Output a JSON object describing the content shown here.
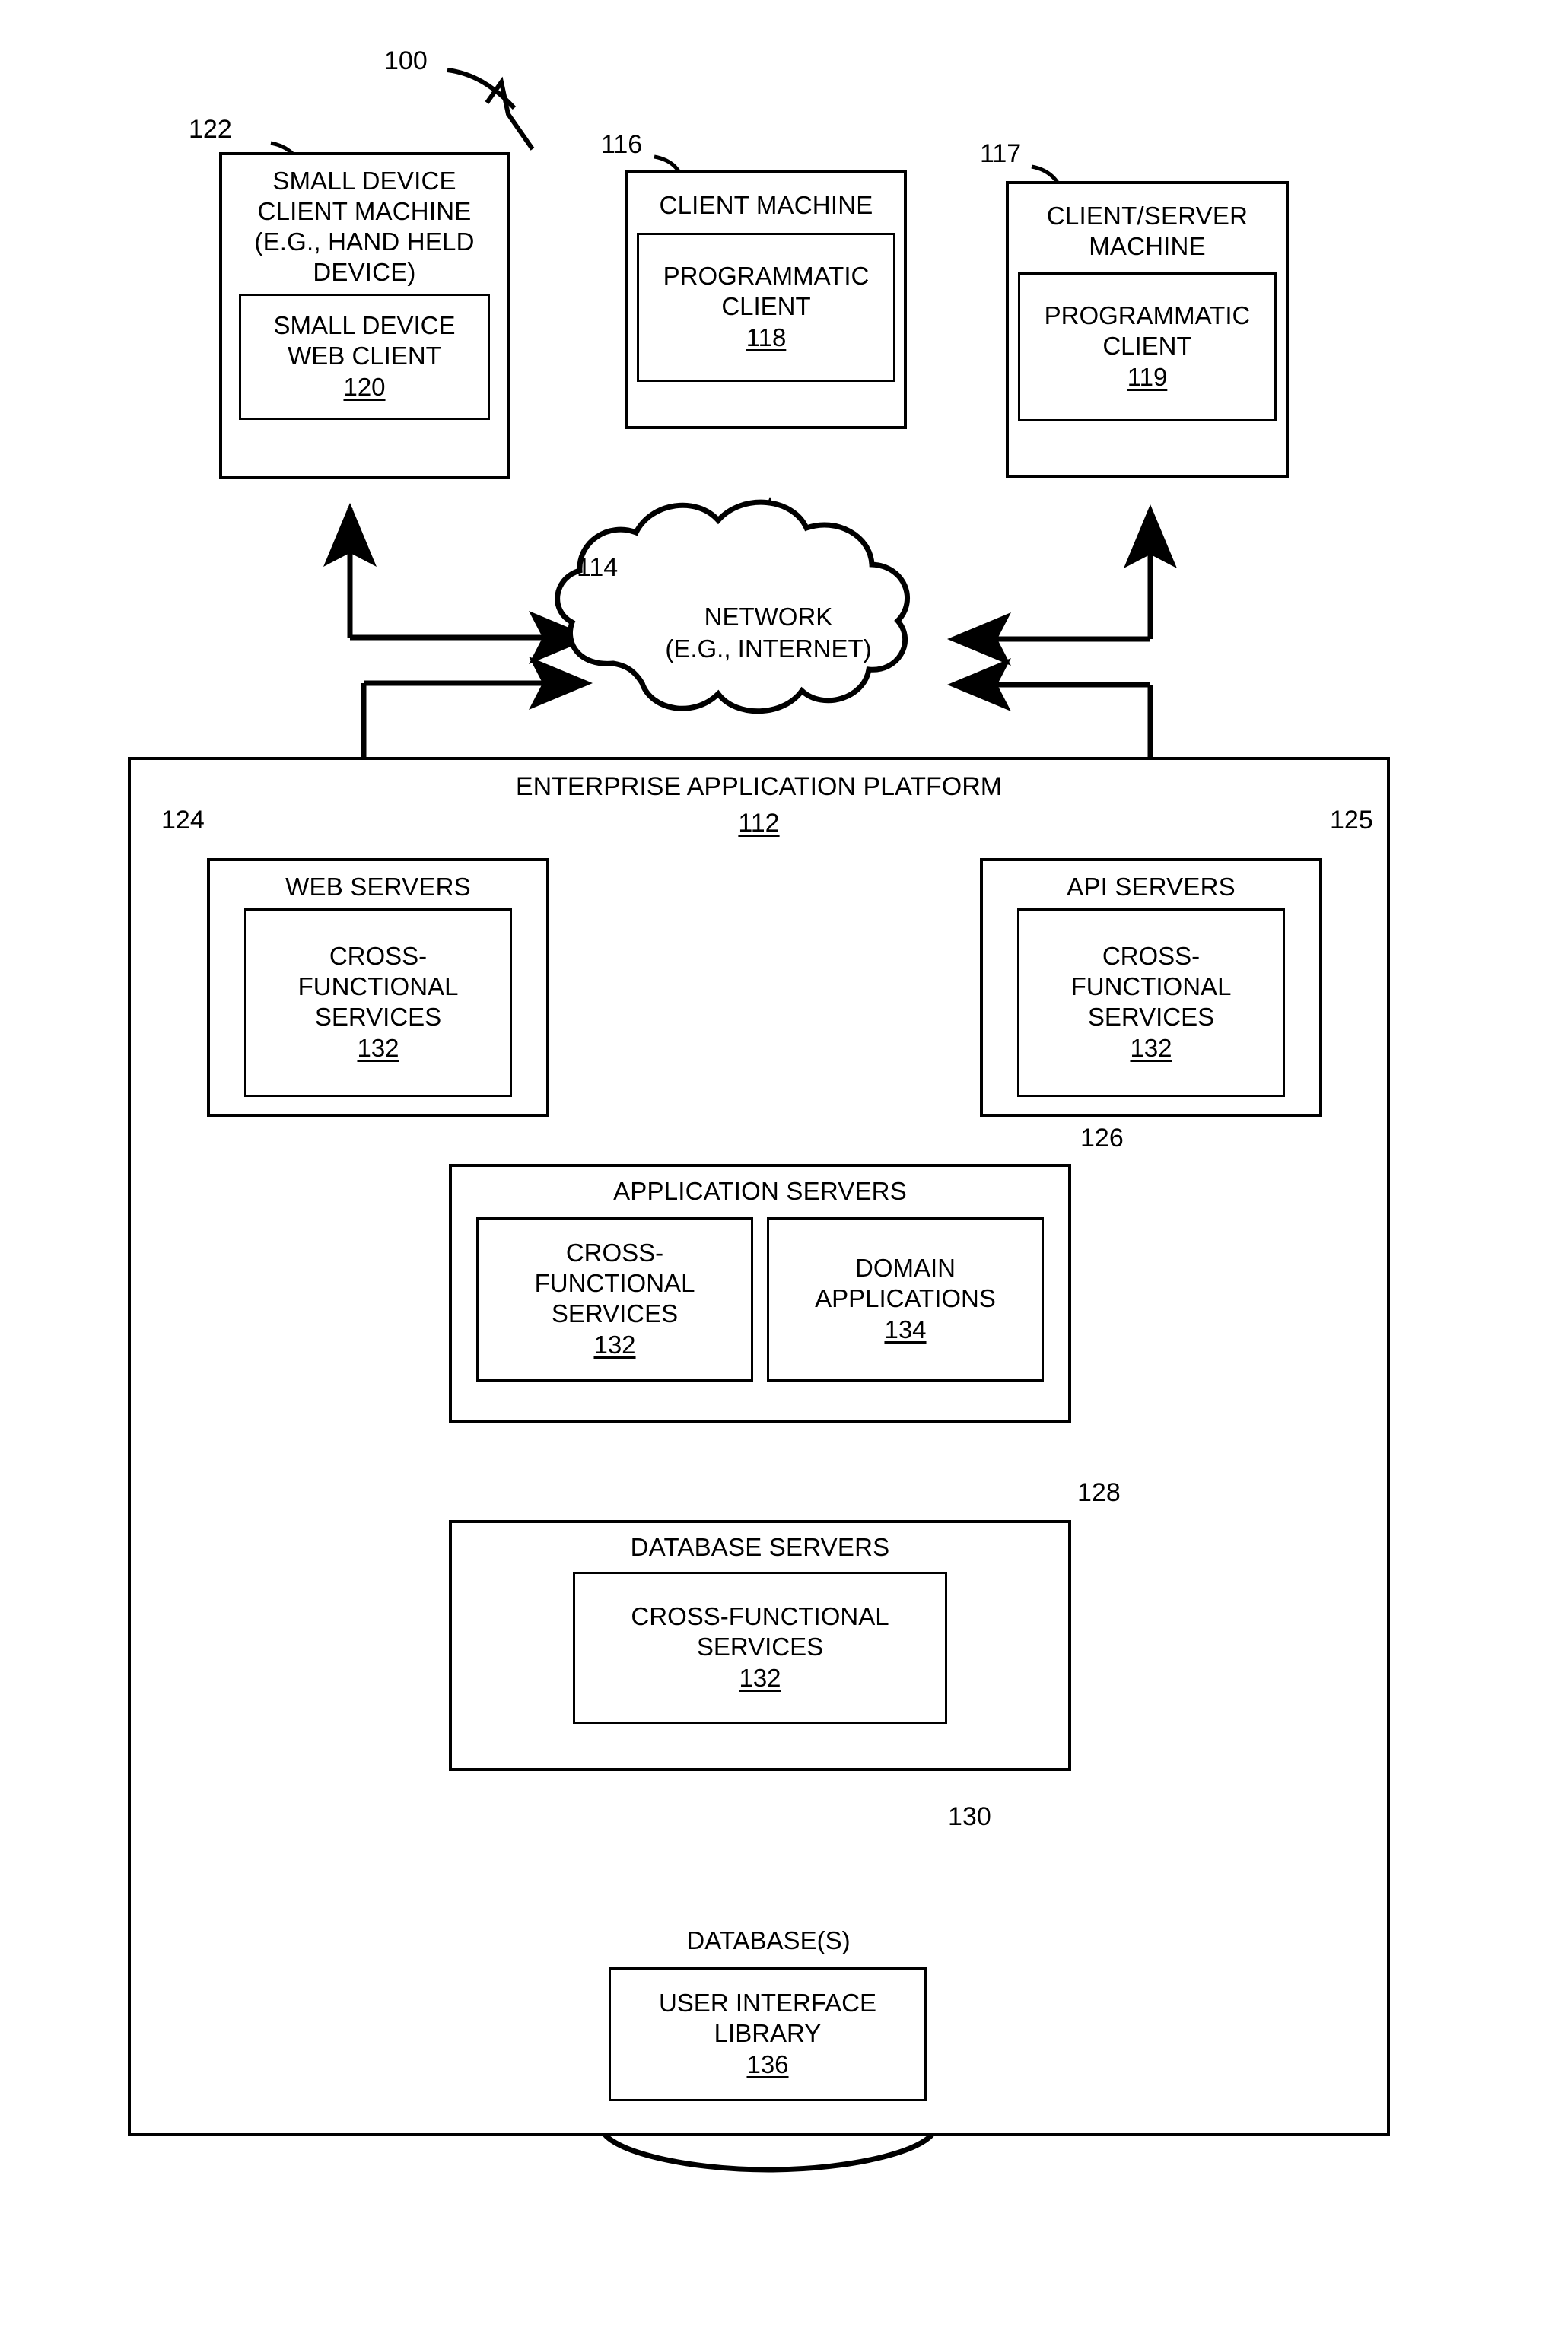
{
  "figure": {
    "figure_ref": "100"
  },
  "nodes": {
    "small_device_client_machine": {
      "ref": "122",
      "title": "SMALL DEVICE\nCLIENT MACHINE\n(E.G., HAND HELD\nDEVICE)",
      "inner": {
        "title": "SMALL DEVICE\nWEB CLIENT",
        "ref": "120"
      }
    },
    "client_machine": {
      "ref": "116",
      "title": "CLIENT MACHINE",
      "inner": {
        "title": "PROGRAMMATIC\nCLIENT",
        "ref": "118"
      }
    },
    "client_server_machine": {
      "ref": "117",
      "title": "CLIENT/SERVER\nMACHINE",
      "inner": {
        "title": "PROGRAMMATIC\nCLIENT",
        "ref": "119"
      }
    },
    "network": {
      "ref": "114",
      "title": "NETWORK\n(E.G., INTERNET)"
    },
    "enterprise_application_platform": {
      "ref": "112",
      "title": "ENTERPRISE APPLICATION PLATFORM"
    },
    "web_servers": {
      "ref": "124",
      "title": "WEB SERVERS",
      "inner": {
        "title": "CROSS-\nFUNCTIONAL\nSERVICES",
        "ref": "132"
      }
    },
    "api_servers": {
      "ref": "125",
      "title": "API SERVERS",
      "inner": {
        "title": "CROSS-\nFUNCTIONAL\nSERVICES",
        "ref": "132"
      }
    },
    "application_servers": {
      "ref": "126",
      "title": "APPLICATION SERVERS",
      "inner_left": {
        "title": "CROSS-\nFUNCTIONAL\nSERVICES",
        "ref": "132"
      },
      "inner_right": {
        "title": "DOMAIN\nAPPLICATIONS",
        "ref": "134"
      }
    },
    "database_servers": {
      "ref": "128",
      "title": "DATABASE SERVERS",
      "inner": {
        "title": "CROSS-FUNCTIONAL\nSERVICES",
        "ref": "132"
      }
    },
    "databases": {
      "ref": "130",
      "title": "DATABASE(S)",
      "inner": {
        "title": "USER INTERFACE\nLIBRARY",
        "ref": "136"
      }
    }
  },
  "colors": {
    "stroke": "#000000",
    "background": "#ffffff"
  }
}
